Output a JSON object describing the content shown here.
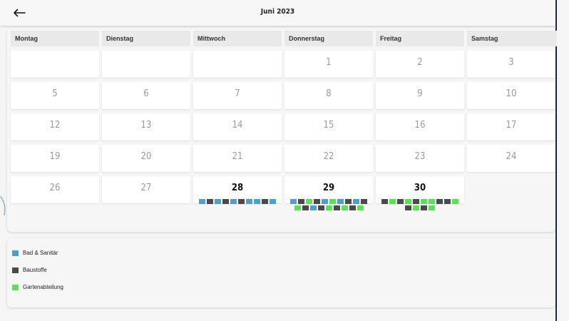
{
  "header": {
    "title": "Juni 2023",
    "back_icon": "arrow-left-icon"
  },
  "calendar": {
    "weekdays": [
      "Montag",
      "Dienstag",
      "Mittwoch",
      "Donnerstag",
      "Freitag",
      "Samstag"
    ],
    "weeks": [
      [
        null,
        null,
        null,
        1,
        2,
        3
      ],
      [
        5,
        6,
        7,
        8,
        9,
        10
      ],
      [
        12,
        13,
        14,
        15,
        16,
        17
      ],
      [
        19,
        20,
        21,
        22,
        23,
        24
      ],
      [
        26,
        27,
        28,
        29,
        30,
        null
      ]
    ],
    "active_days": [
      28,
      29,
      30
    ],
    "events": {
      "28": [
        "bad",
        "bau",
        "bad",
        "bau",
        "bad",
        "bau",
        "bad",
        "bad",
        "bau",
        "bad"
      ],
      "29": [
        "bad",
        "bau",
        "garten",
        "bau",
        "bad",
        "garten",
        "bad",
        "bau",
        "bad",
        "bau",
        "garten",
        "bau",
        "bad",
        "bau",
        "garten",
        "bau",
        "garten",
        "bau",
        "garten"
      ],
      "30": [
        "bau",
        "garten",
        "bau",
        "garten",
        "bau",
        "garten",
        "garten",
        "bau",
        "bau",
        "garten",
        "bau",
        "garten",
        "bau",
        "garten"
      ]
    }
  },
  "categories": {
    "bad": {
      "label": "Bad & Sanitär",
      "color": "#4a9fd4"
    },
    "bau": {
      "label": "Baustoffe",
      "color": "#4a4a4a"
    },
    "garten": {
      "label": "Gartenabteilung",
      "color": "#52e652"
    }
  },
  "legend": [
    {
      "key": "bad",
      "label": "Bad & Sanitär",
      "color": "#4a9fd4"
    },
    {
      "key": "bau",
      "label": "Baustoffe",
      "color": "#4a4a4a"
    },
    {
      "key": "garten",
      "label": "Gartenabteilung",
      "color": "#52e652"
    }
  ]
}
